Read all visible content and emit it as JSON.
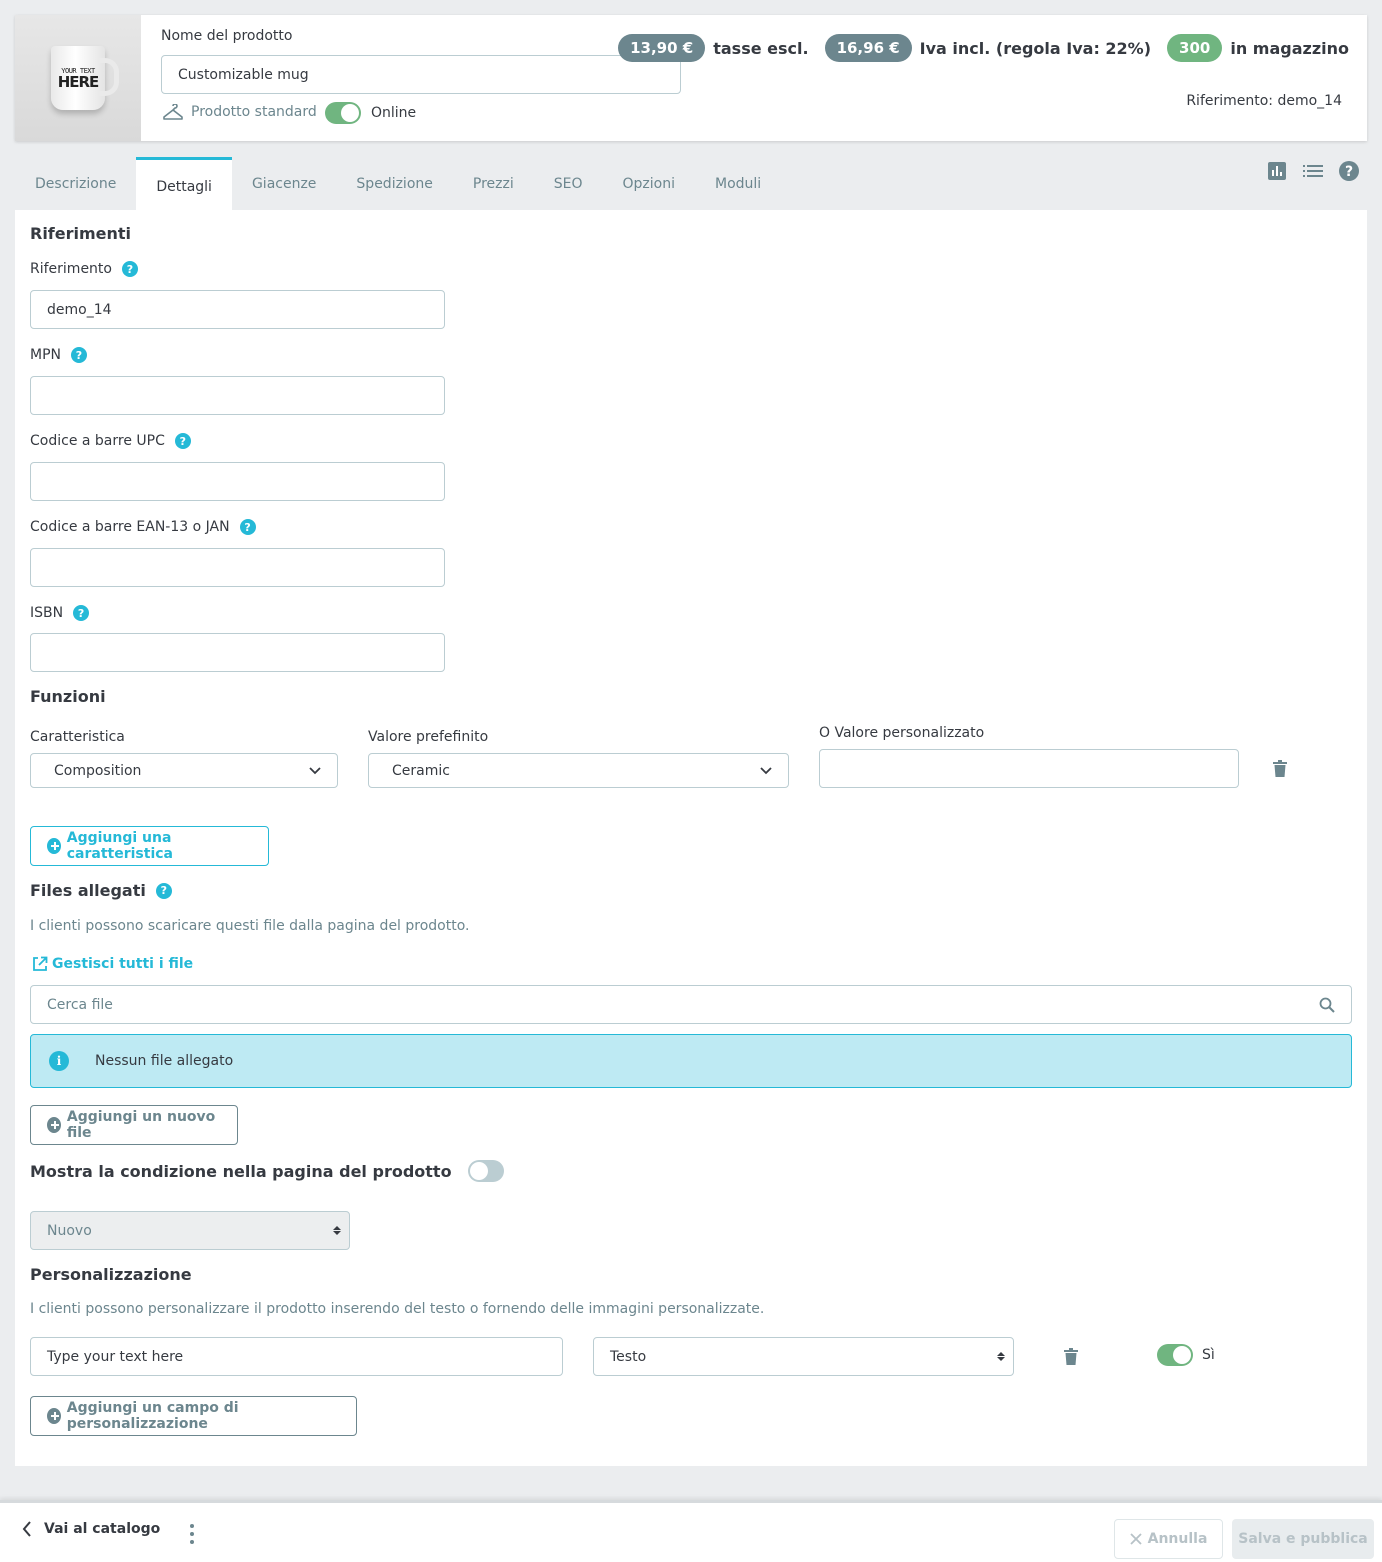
{
  "header": {
    "mug_line1": "YOUR TEXT",
    "mug_line2": "HERE",
    "name_label": "Nome del prodotto",
    "name_value": "Customizable mug",
    "product_type": "Prodotto standard",
    "online_label": "Online",
    "price_excl": "13,90 €",
    "price_excl_label": "tasse escl.",
    "price_incl": "16,96 €",
    "price_incl_label": "Iva incl. (regola Iva: 22%)",
    "stock": "300",
    "stock_label": "in magazzino",
    "reference": "Riferimento: demo_14"
  },
  "tabs": [
    "Descrizione",
    "Dettagli",
    "Giacenze",
    "Spedizione",
    "Prezzi",
    "SEO",
    "Opzioni",
    "Moduli"
  ],
  "references": {
    "title": "Riferimenti",
    "ref_label": "Riferimento",
    "ref_value": "demo_14",
    "mpn_label": "MPN",
    "upc_label": "Codice a barre UPC",
    "ean_label": "Codice a barre EAN-13 o JAN",
    "isbn_label": "ISBN"
  },
  "features": {
    "title": "Funzioni",
    "feature_label": "Caratteristica",
    "feature_value": "Composition",
    "predef_label": "Valore prefefinito",
    "predef_value": "Ceramic",
    "custom_label": "O Valore personalizzato",
    "add_button": "Aggiungi una caratteristica"
  },
  "files": {
    "title": "Files allegati",
    "description": "I clienti possono scaricare questi file dalla pagina del prodotto.",
    "manage_link": "Gestisci tutti i file",
    "search_placeholder": "Cerca file",
    "empty_alert": "Nessun file allegato",
    "add_button": "Aggiungi un nuovo file"
  },
  "condition": {
    "title": "Mostra la condizione nella pagina del prodotto",
    "value": "Nuovo"
  },
  "customization": {
    "title": "Personalizzazione",
    "description": "I clienti possono personalizzare il prodotto inserendo del testo o fornendo delle immagini personalizzate.",
    "field_value": "Type your text here",
    "type_value": "Testo",
    "required_label": "Sì",
    "add_button": "Aggiungi un campo di personalizzazione"
  },
  "footer": {
    "back_label": "Vai al catalogo",
    "cancel_label": "Annulla",
    "save_label": "Salva e pubblica"
  },
  "colors": {
    "primary": "#25b9d7",
    "success": "#70b580",
    "text": "#363a41",
    "muted": "#6c868e"
  }
}
